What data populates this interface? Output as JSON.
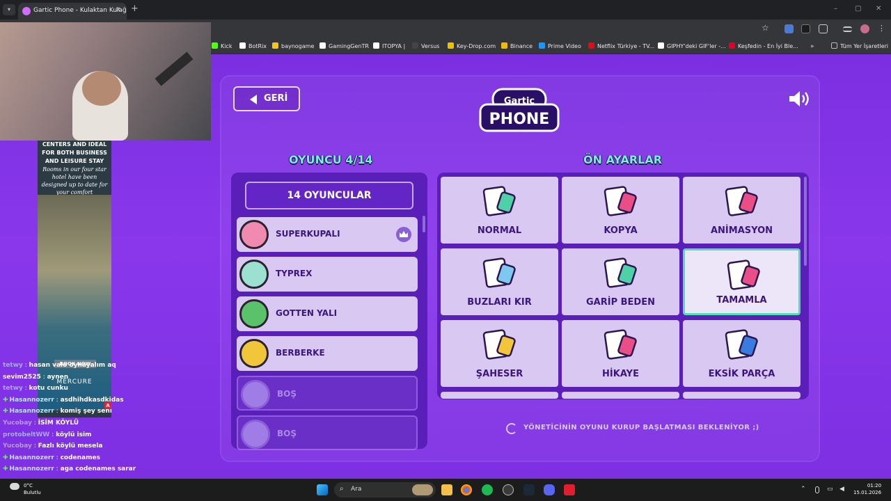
{
  "browser": {
    "tab_title": "Gartic Phone - Kulaktan Kulağa",
    "new_tab": "+",
    "window_controls": [
      "–",
      "▢",
      "✕"
    ],
    "bookmarks": [
      {
        "label": "Kick",
        "color": "#53fc18"
      },
      {
        "label": "BotRix",
        "color": "#ffffff"
      },
      {
        "label": "baynogame",
        "color": "#f5c518"
      },
      {
        "label": "GamingGenTR",
        "color": "#ffffff"
      },
      {
        "label": "ITOPYA |",
        "color": "#ffffff"
      },
      {
        "label": "Versus",
        "color": "#444444"
      },
      {
        "label": "Key-Drop.com",
        "color": "#f0c000"
      },
      {
        "label": "Binance",
        "color": "#f0b90b"
      },
      {
        "label": "Prime Video",
        "color": "#1a98ff"
      },
      {
        "label": "Netflix Türkiye - TV...",
        "color": "#e50914"
      },
      {
        "label": "GIPHY'deki GIF'ler -...",
        "color": "#ffffff"
      },
      {
        "label": "Keşfedin - En İyi Ble...",
        "color": "#e60023"
      }
    ],
    "all_bookmarks": "Tüm Yer İşaretleri",
    "overflow": "»"
  },
  "game": {
    "back_label": "GERİ",
    "logo_top": "Gartic",
    "logo_bottom": "PHONE",
    "players_title": "OYUNCU 4/14",
    "presets_title": "ÖN AYARLAR",
    "player_count": "14 OYUNCULAR",
    "players": [
      {
        "name": "SUPERKUPALI",
        "color": "#f08ab0",
        "crown": true
      },
      {
        "name": "TYPREX",
        "color": "#9be0d0"
      },
      {
        "name": "GOTTEN YALI",
        "color": "#5ac26a"
      },
      {
        "name": "BERBERKE",
        "color": "#f2c63a"
      },
      {
        "name": "BOŞ"
      },
      {
        "name": "BOŞ"
      }
    ],
    "presets": [
      {
        "label": "NORMAL",
        "icon": "pencil-notepad-icon",
        "color": "#4fd1a8"
      },
      {
        "label": "KOPYA",
        "icon": "cards-copy-icon",
        "color": "#e94f86"
      },
      {
        "label": "ANİMASYON",
        "icon": "animation-pin-icon",
        "color": "#e94f86"
      },
      {
        "label": "BUZLARI KIR",
        "icon": "ice-hammer-icon",
        "color": "#7cc8f0"
      },
      {
        "label": "GARİP BEDEN",
        "icon": "strange-body-icon",
        "color": "#4fd1a8"
      },
      {
        "label": "TAMAMLA",
        "icon": "puzzle-apple-icon",
        "color": "#e94f86",
        "selected": true
      },
      {
        "label": "ŞAHESER",
        "icon": "masterpiece-frame-icon",
        "color": "#f2c63a"
      },
      {
        "label": "HİKAYE",
        "icon": "story-scroll-icon",
        "color": "#e94f86"
      },
      {
        "label": "EKSİK PARÇA",
        "icon": "missing-piece-icon",
        "color": "#3a7be0"
      }
    ],
    "waiting_text": "YÖNETİCİNİN OYUNU KURUP BAŞLATMASI BEKLENİYOR ;)"
  },
  "ad": {
    "headline": "CENTERS AND IDEAL FOR BOTH BUSINESS AND LEISURE STAY",
    "body": "Rooms in our four star hotel have been designed up to date for your comfort",
    "cta": "BOOK NOW",
    "brand": "MERCURE"
  },
  "chat": [
    {
      "user": "tetwy",
      "text": "hasan valo oynayalım aq",
      "user_color": "#a8a8ff"
    },
    {
      "user": "sevim2525",
      "text": "aynen",
      "user_color": "#ffffff"
    },
    {
      "user": "tetwy",
      "text": "kotu cunku",
      "user_color": "#a8a8ff"
    },
    {
      "user": "Hasannozerr",
      "text": "asdhihdkasdkidas",
      "user_color": "#b8e6ff",
      "plus": true
    },
    {
      "user": "Hasannozerr",
      "text": "komiş şey seni",
      "user_color": "#b8e6ff",
      "plus": true
    },
    {
      "user": "Yucobay",
      "text": "İSİM KÖYLÜ",
      "user_color": "#b89ad8"
    },
    {
      "user": "protobeltWW",
      "text": "köylü isim",
      "user_color": "#a8a8ff"
    },
    {
      "user": "Yucobay",
      "text": "Fazlı köylü mesela",
      "user_color": "#b89ad8"
    },
    {
      "user": "Hasannozerr",
      "text": "codenames",
      "user_color": "#b8e6ff",
      "plus": true
    },
    {
      "user": "Hasannozerr",
      "text": "aga codenames sarar",
      "user_color": "#b8e6ff",
      "plus": true
    }
  ],
  "taskbar": {
    "temperature": "0°C",
    "weather": "Bulutlu",
    "search_placeholder": "Ara",
    "time": "01:20",
    "date": "15.01.2026"
  }
}
